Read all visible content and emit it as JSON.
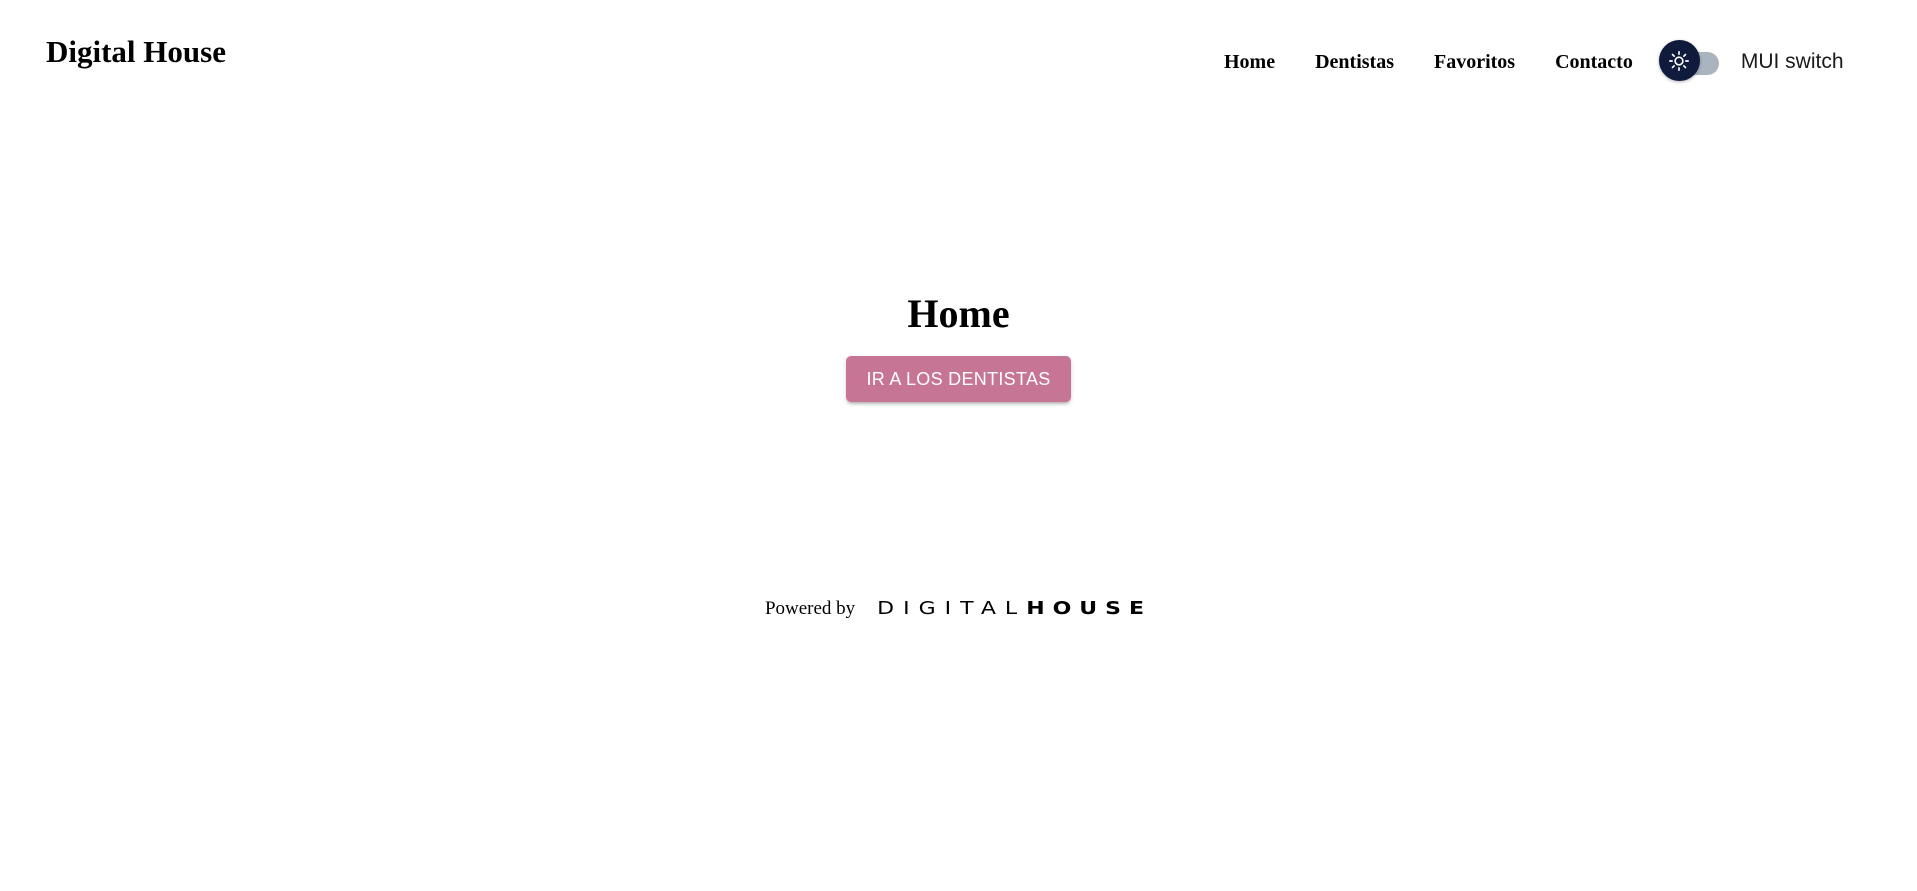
{
  "header": {
    "brand": "Digital House",
    "nav": [
      {
        "label": "Home"
      },
      {
        "label": "Dentistas"
      },
      {
        "label": "Favoritos"
      },
      {
        "label": "Contacto"
      }
    ],
    "theme_switch": {
      "label": "MUI switch",
      "checked": false,
      "icon": "sun-icon",
      "thumb_color": "#0f1a3c",
      "track_color": "#aab4be"
    }
  },
  "main": {
    "title": "Home",
    "button_label": "IR A LOS DENTISTAS",
    "button_color": "#c77595"
  },
  "footer": {
    "powered_by": "Powered by",
    "logo_light": "DIGITAL",
    "logo_heavy": "HOUSE"
  }
}
